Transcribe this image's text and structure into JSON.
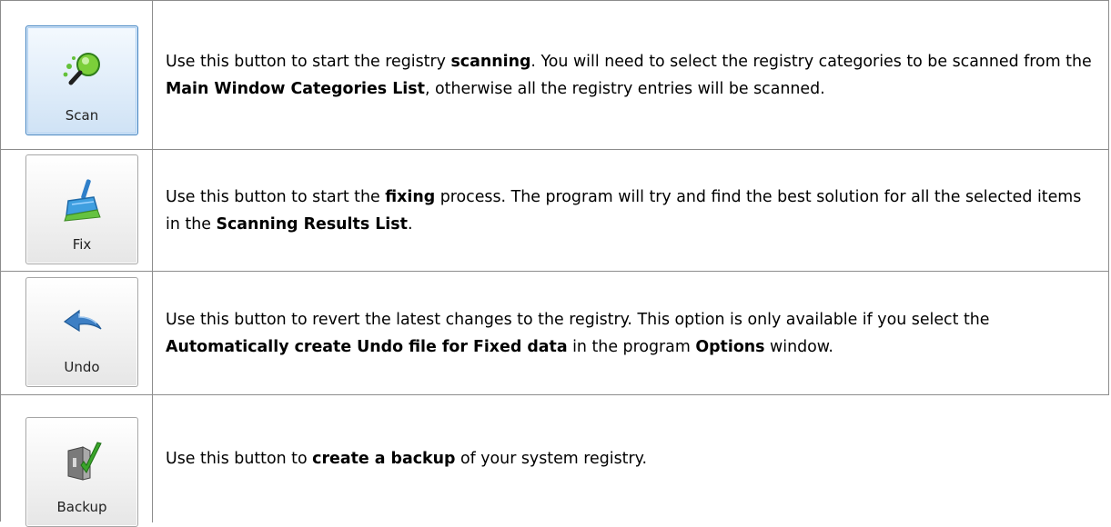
{
  "rows": [
    {
      "button_label": "Scan",
      "icon": "magnifier-icon",
      "desc_html": "Use this button to start the registry <b>scanning</b>. You will need to select the registry categories to be scanned from the <b>Main Window Categories List</b>, otherwise all the registry entries will be scanned."
    },
    {
      "button_label": "Fix",
      "icon": "broom-icon",
      "desc_html": "Use this button to start the <b>fixing</b> process. The program will try and find the best solution for all the selected items in the <b>Scanning Results List</b>."
    },
    {
      "button_label": "Undo",
      "icon": "undo-arrow-icon",
      "desc_html": "Use this button to revert the latest changes to the registry. This option is only available if you select the <b>Automatically create Undo file for Fixed data</b> in the program <b>Options</b> window."
    },
    {
      "button_label": "Backup",
      "icon": "backup-check-icon",
      "desc_html": "Use this button to <b>create a backup</b> of your system registry."
    }
  ],
  "colors": {
    "border": "#8c8c8c",
    "active_button_border": "#3b7fbf",
    "scan_green": "#4caf2f",
    "fix_blue": "#2f8fd6",
    "undo_blue": "#3d7fc4",
    "backup_check": "#3aa52b"
  }
}
